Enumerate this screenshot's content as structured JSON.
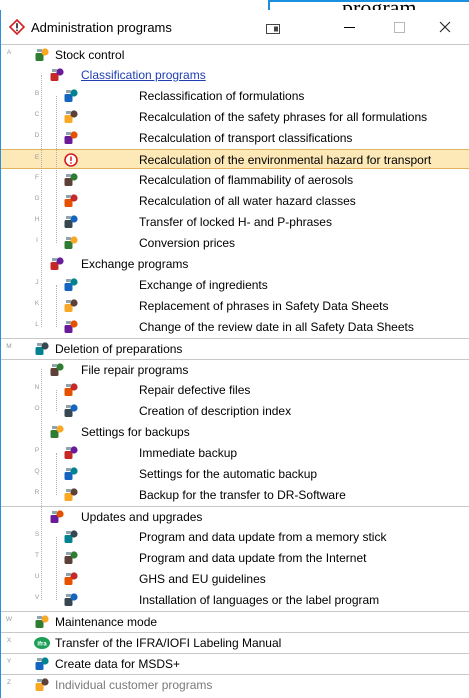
{
  "background_window_text": "program",
  "title": "Administration programs",
  "controls": {
    "minimize": "minimize-icon",
    "maximize": "maximize-icon",
    "close": "close-icon"
  },
  "rows": [
    {
      "key": "A",
      "label": "Stock control",
      "level": 0,
      "group": true,
      "icon": "stock-control-icon"
    },
    {
      "key": "",
      "label": "Classification programs",
      "level": 1,
      "link": true,
      "icon": "classification-icon"
    },
    {
      "key": "B",
      "label": "Reclassification of formulations",
      "level": 2,
      "icon": "reclassification-icon"
    },
    {
      "key": "C",
      "label": "Recalculation of the safety phrases for all formulations",
      "level": 2,
      "icon": "safety-phrases-icon"
    },
    {
      "key": "D",
      "label": "Recalculation of transport classifications",
      "level": 2,
      "icon": "transport-icon"
    },
    {
      "key": "E",
      "label": "Recalculation of the environmental hazard for transport",
      "level": 2,
      "selected": true,
      "icon": "environmental-hazard-icon"
    },
    {
      "key": "F",
      "label": "Recalculation of flammability of aerosols",
      "level": 2,
      "icon": "aerosol-icon"
    },
    {
      "key": "G",
      "label": "Recalculation of all water hazard classes",
      "level": 2,
      "icon": "water-hazard-icon"
    },
    {
      "key": "H",
      "label": "Transfer of locked H- and P-phrases",
      "level": 2,
      "icon": "hp-phrases-icon"
    },
    {
      "key": "I",
      "label": "Conversion prices",
      "level": 2,
      "icon": "conversion-icon"
    },
    {
      "key": "",
      "label": "Exchange programs",
      "level": 1,
      "icon": "exchange-icon"
    },
    {
      "key": "J",
      "label": "Exchange of ingredients",
      "level": 2,
      "icon": "ingredients-icon"
    },
    {
      "key": "K",
      "label": "Replacement of phrases in Safety Data Sheets",
      "level": 2,
      "icon": "phrase-replace-icon"
    },
    {
      "key": "L",
      "label": "Change of the review date in all Safety Data Sheets",
      "level": 2,
      "icon": "calendar-icon"
    },
    {
      "key": "M",
      "label": "Deletion of preparations",
      "level": 0,
      "group": true,
      "icon": "trash-icon"
    },
    {
      "key": "",
      "label": "File repair programs",
      "level": 1,
      "group": true,
      "icon": "file-repair-icon"
    },
    {
      "key": "N",
      "label": "Repair defective files",
      "level": 2,
      "icon": "repair-files-icon"
    },
    {
      "key": "O",
      "label": "Creation of description index",
      "level": 2,
      "icon": "index-icon"
    },
    {
      "key": "",
      "label": "Settings for backups",
      "level": 1,
      "icon": "backup-settings-icon"
    },
    {
      "key": "P",
      "label": "Immediate backup",
      "level": 2,
      "icon": "immediate-backup-icon"
    },
    {
      "key": "Q",
      "label": "Settings for the automatic backup",
      "level": 2,
      "icon": "auto-backup-icon"
    },
    {
      "key": "R",
      "label": "Backup for the transfer to DR-Software",
      "level": 2,
      "icon": "transfer-backup-icon"
    },
    {
      "key": "",
      "label": "Updates and upgrades",
      "level": 1,
      "group": true,
      "icon": "updates-icon"
    },
    {
      "key": "S",
      "label": "Program and data update from a memory stick",
      "level": 2,
      "icon": "memory-stick-icon"
    },
    {
      "key": "T",
      "label": "Program and data update from the Internet",
      "level": 2,
      "icon": "globe-icon"
    },
    {
      "key": "U",
      "label": "GHS and EU guidelines",
      "level": 2,
      "icon": "ghs-icon"
    },
    {
      "key": "V",
      "label": "Installation of languages or the label program",
      "level": 2,
      "icon": "languages-icon"
    },
    {
      "key": "W",
      "label": "Maintenance mode",
      "level": 0,
      "group": true,
      "icon": "maintenance-icon"
    },
    {
      "key": "X",
      "label": "Transfer of the IFRA/IOFI Labeling Manual",
      "level": 0,
      "group": true,
      "icon": "ifra-icon",
      "badge": "ifra"
    },
    {
      "key": "Y",
      "label": "Create data for MSDS+",
      "level": 0,
      "group": true,
      "icon": "msds-icon"
    },
    {
      "key": "Z",
      "label": "Individual customer programs",
      "level": 0,
      "group": true,
      "gray": true,
      "icon": "customer-programs-icon"
    }
  ],
  "colors": {
    "selected_bg": "#fde8b7",
    "link": "#1f3eb4",
    "accent": "#1b8fe0"
  }
}
